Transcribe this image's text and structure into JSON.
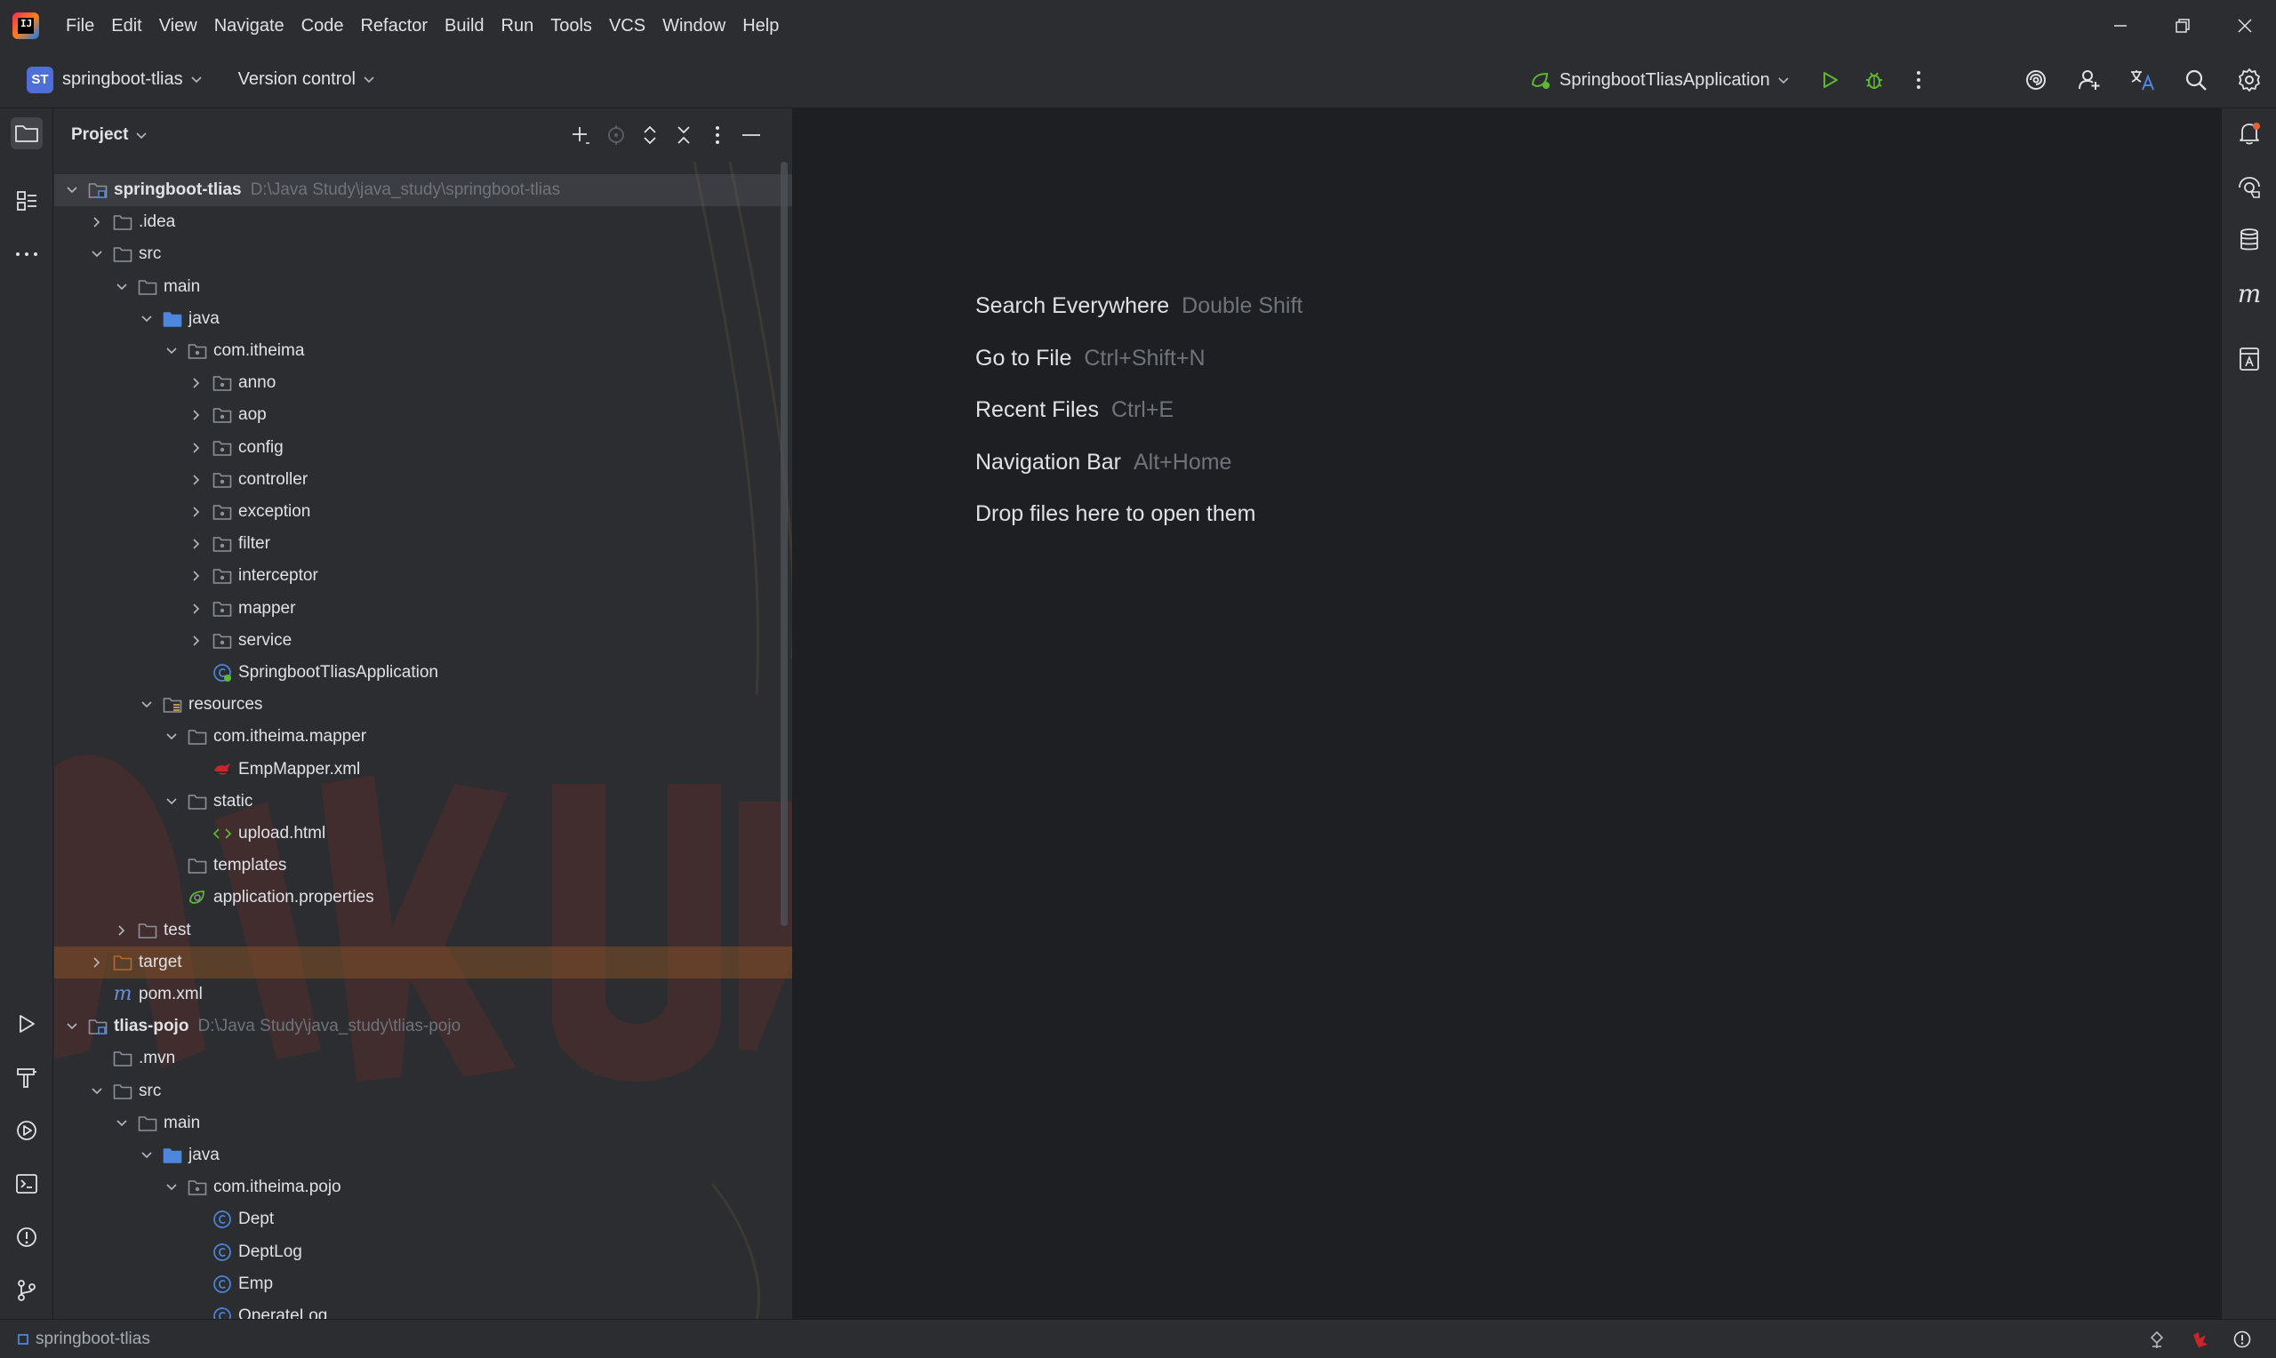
{
  "menu": [
    "File",
    "Edit",
    "View",
    "Navigate",
    "Code",
    "Refactor",
    "Build",
    "Run",
    "Tools",
    "VCS",
    "Window",
    "Help"
  ],
  "toolbar": {
    "project_initials": "ST",
    "project_name": "springboot-tlias",
    "vcs_label": "Version control",
    "run_config": "SpringbootTliasApplication"
  },
  "project_panel": {
    "title": "Project",
    "tree": [
      {
        "depth": 0,
        "expanded": true,
        "label": "springboot-tlias",
        "path": "D:\\Java Study\\java_study\\springboot-tlias",
        "icon": "module-folder-icon",
        "bold": true,
        "state": "selected"
      },
      {
        "depth": 1,
        "expanded": false,
        "label": ".idea",
        "icon": "folder-icon"
      },
      {
        "depth": 1,
        "expanded": true,
        "label": "src",
        "icon": "folder-icon"
      },
      {
        "depth": 2,
        "expanded": true,
        "label": "main",
        "icon": "folder-icon"
      },
      {
        "depth": 3,
        "expanded": true,
        "label": "java",
        "icon": "source-folder-icon"
      },
      {
        "depth": 4,
        "expanded": true,
        "label": "com.itheima",
        "icon": "package-icon"
      },
      {
        "depth": 5,
        "expanded": false,
        "label": "anno",
        "icon": "package-icon"
      },
      {
        "depth": 5,
        "expanded": false,
        "label": "aop",
        "icon": "package-icon"
      },
      {
        "depth": 5,
        "expanded": false,
        "label": "config",
        "icon": "package-icon"
      },
      {
        "depth": 5,
        "expanded": false,
        "label": "controller",
        "icon": "package-icon"
      },
      {
        "depth": 5,
        "expanded": false,
        "label": "exception",
        "icon": "package-icon"
      },
      {
        "depth": 5,
        "expanded": false,
        "label": "filter",
        "icon": "package-icon"
      },
      {
        "depth": 5,
        "expanded": false,
        "label": "interceptor",
        "icon": "package-icon"
      },
      {
        "depth": 5,
        "expanded": false,
        "label": "mapper",
        "icon": "package-icon"
      },
      {
        "depth": 5,
        "expanded": false,
        "label": "service",
        "icon": "package-icon"
      },
      {
        "depth": 5,
        "label": "SpringbootTliasApplication",
        "icon": "spring-boot-class-icon"
      },
      {
        "depth": 3,
        "expanded": true,
        "label": "resources",
        "icon": "resources-folder-icon"
      },
      {
        "depth": 4,
        "expanded": true,
        "label": "com.itheima.mapper",
        "icon": "folder-icon"
      },
      {
        "depth": 5,
        "label": "EmpMapper.xml",
        "icon": "mybatis-xml-icon"
      },
      {
        "depth": 4,
        "expanded": true,
        "label": "static",
        "icon": "folder-icon"
      },
      {
        "depth": 5,
        "label": "upload.html",
        "icon": "html-file-icon"
      },
      {
        "depth": 4,
        "label": "templates",
        "icon": "folder-icon"
      },
      {
        "depth": 4,
        "label": "application.properties",
        "icon": "spring-properties-icon"
      },
      {
        "depth": 2,
        "expanded": false,
        "label": "test",
        "icon": "folder-icon"
      },
      {
        "depth": 1,
        "expanded": false,
        "label": "target",
        "icon": "excluded-folder-icon",
        "state": "excluded"
      },
      {
        "depth": 1,
        "label": "pom.xml",
        "icon": "maven-icon"
      },
      {
        "depth": 0,
        "expanded": true,
        "label": "tlias-pojo",
        "path": "D:\\Java Study\\java_study\\tlias-pojo",
        "icon": "module-folder-icon",
        "bold": true
      },
      {
        "depth": 1,
        "label": ".mvn",
        "icon": "folder-icon"
      },
      {
        "depth": 1,
        "expanded": true,
        "label": "src",
        "icon": "folder-icon"
      },
      {
        "depth": 2,
        "expanded": true,
        "label": "main",
        "icon": "folder-icon"
      },
      {
        "depth": 3,
        "expanded": true,
        "label": "java",
        "icon": "source-folder-icon"
      },
      {
        "depth": 4,
        "expanded": true,
        "label": "com.itheima.pojo",
        "icon": "package-icon"
      },
      {
        "depth": 5,
        "label": "Dept",
        "icon": "class-icon"
      },
      {
        "depth": 5,
        "label": "DeptLog",
        "icon": "class-icon"
      },
      {
        "depth": 5,
        "label": "Emp",
        "icon": "class-icon"
      },
      {
        "depth": 5,
        "label": "OperateLog",
        "icon": "class-icon"
      }
    ]
  },
  "editor": {
    "hints": [
      {
        "action": "Search Everywhere",
        "shortcut": "Double Shift"
      },
      {
        "action": "Go to File",
        "shortcut": "Ctrl+Shift+N"
      },
      {
        "action": "Recent Files",
        "shortcut": "Ctrl+E"
      },
      {
        "action": "Navigation Bar",
        "shortcut": "Alt+Home"
      },
      {
        "action": "Drop files here to open them",
        "shortcut": ""
      }
    ]
  },
  "statusbar": {
    "breadcrumb": "springboot-tlias"
  },
  "colors": {
    "folder": "#8d9199",
    "source_folder": "#4d86dc",
    "class": "#4d86dc",
    "spring": "#5fb832",
    "excluded": "#b36a2e",
    "maven": "#6a8fd8"
  }
}
